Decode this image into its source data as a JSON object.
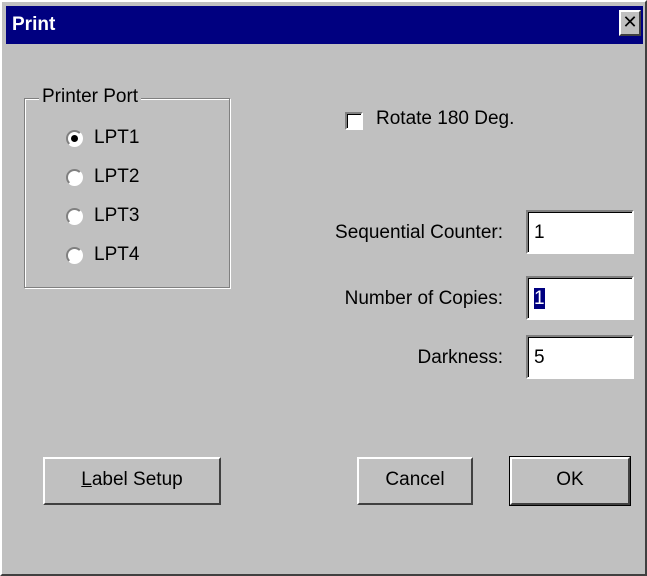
{
  "window": {
    "title": "Print",
    "close_glyph": "✕",
    "close_icon": "close-icon"
  },
  "printer_port": {
    "legend": "Printer Port",
    "options": [
      {
        "label": "LPT1",
        "checked": true
      },
      {
        "label": "LPT2",
        "checked": false
      },
      {
        "label": "LPT3",
        "checked": false
      },
      {
        "label": "LPT4",
        "checked": false
      }
    ]
  },
  "rotate": {
    "label": "Rotate 180 Deg.",
    "checked": false
  },
  "fields": {
    "sequential_counter": {
      "label": "Sequential Counter:",
      "value": "1"
    },
    "number_of_copies": {
      "label": "Number of Copies:",
      "value": "1"
    },
    "darkness": {
      "label": "Darkness:",
      "value": "5"
    }
  },
  "buttons": {
    "label_setup": "Label Setup",
    "cancel": "Cancel",
    "ok": "OK"
  },
  "colors": {
    "titlebar": "#000080",
    "face": "#c0c0c0",
    "selection": "#000080"
  }
}
